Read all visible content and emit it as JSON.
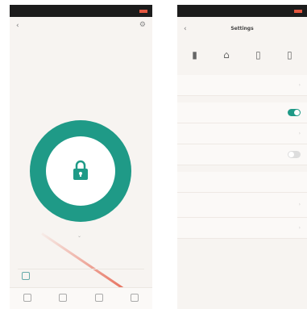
{
  "left": {
    "statusbar": {
      "carrier": "",
      "time": ""
    },
    "header": {
      "device_name": "",
      "device_sub": ""
    },
    "lock_status": {
      "label": "",
      "value": ""
    },
    "unlock_button": {
      "text": ""
    },
    "record": {
      "text": ""
    },
    "nav": [
      {
        "label": "",
        "icon": "lock-icon"
      },
      {
        "label": "",
        "icon": "list-icon"
      },
      {
        "label": "",
        "icon": "key-icon"
      },
      {
        "label": "",
        "icon": "settings-icon"
      }
    ]
  },
  "right": {
    "title": "Settings",
    "quick_icons": [
      {
        "label": "",
        "icon": "device-icon"
      },
      {
        "label": "",
        "icon": "lock-icon"
      },
      {
        "label": "",
        "icon": "phone-icon"
      },
      {
        "label": "",
        "icon": "more-icon"
      }
    ],
    "rows": [
      {
        "label": "",
        "control": "chevron"
      },
      {
        "label": "",
        "control": "toggle-on"
      },
      {
        "label": "",
        "control": "chevron"
      },
      {
        "label": "",
        "control": "toggle-off"
      },
      {
        "label": "",
        "control": "value",
        "value": ""
      },
      {
        "label": "",
        "control": "chevron"
      },
      {
        "label": "",
        "control": "chevron"
      }
    ]
  },
  "colors": {
    "accent": "#1f9a87",
    "swipe": "#e4563f",
    "statusbar": "#1c1c1c"
  }
}
